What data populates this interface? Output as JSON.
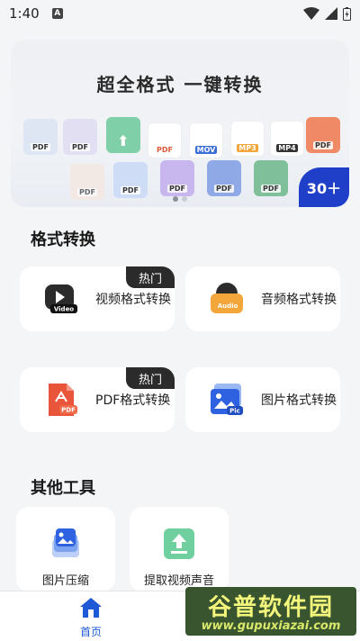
{
  "status_bar": {
    "time": "1:40",
    "notif_letter": "A"
  },
  "banner": {
    "title": "超全格式 一键转换",
    "formats_row1": [
      "PDF",
      "PDF",
      "",
      "PDF",
      "MOV",
      "MP3",
      "MP4",
      "PDF"
    ],
    "formats_row2": [
      "PDF",
      "PDF",
      "PDF",
      "PDF",
      "PDF"
    ],
    "badge": "30＋"
  },
  "section_convert": {
    "title": "格式转换"
  },
  "cards": [
    {
      "label": "视频格式转换",
      "badge": "热门",
      "icon_text": "Video"
    },
    {
      "label": "音频格式转换",
      "badge": "",
      "icon_text": "Audio"
    },
    {
      "label": "PDF格式转换",
      "badge": "热门",
      "icon_text": "PDF"
    },
    {
      "label": "图片格式转换",
      "badge": "",
      "icon_text": "Pic"
    }
  ],
  "section_tools": {
    "title": "其他工具"
  },
  "tools": [
    {
      "label": "图片压缩"
    },
    {
      "label": "提取视频声音"
    }
  ],
  "bottom_nav": {
    "home_label": "首页"
  },
  "watermark": {
    "brand": "谷普软件园",
    "url": "www.gupuxiazai.com"
  },
  "colors": {
    "accent": "#1f5ad6",
    "hot_badge": "#2b2b2b",
    "banner_badge": "#1f3fc9"
  }
}
